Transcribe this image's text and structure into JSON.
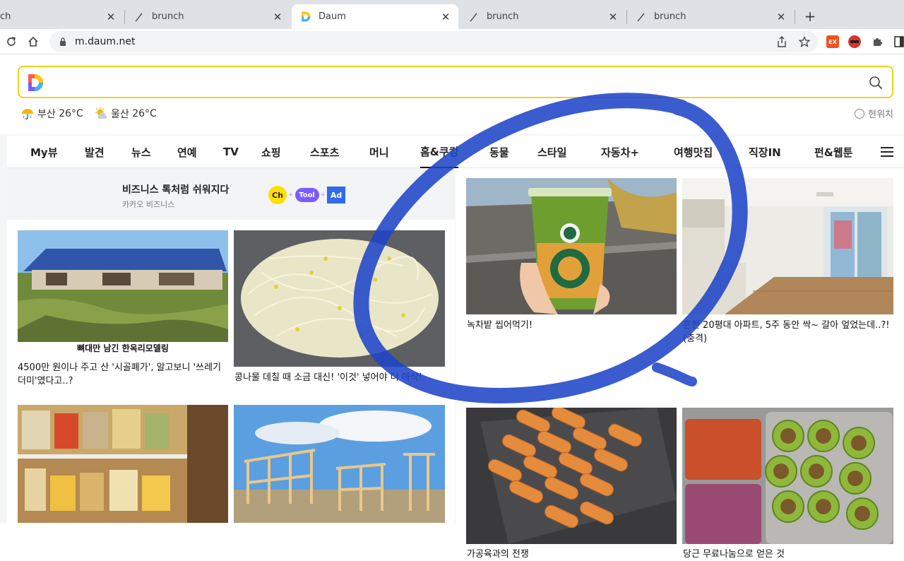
{
  "browser": {
    "tabs": [
      {
        "title": "ch",
        "icon": "page-icon",
        "active": false
      },
      {
        "title": "brunch",
        "icon": "brunch-pen-icon",
        "active": false
      },
      {
        "title": "Daum",
        "icon": "daum-logo-icon",
        "active": true
      },
      {
        "title": "brunch",
        "icon": "brunch-pen-icon",
        "active": false
      },
      {
        "title": "brunch",
        "icon": "brunch-pen-icon",
        "active": false
      }
    ],
    "new_tab": "+",
    "close_glyph": "✕",
    "url": "m.daum.net",
    "extensions": [
      {
        "label": "EX",
        "color": "#f25022"
      },
      {
        "label": "",
        "color": "#e03131"
      }
    ]
  },
  "search": {
    "placeholder": "",
    "brand_colors": [
      "#ff5a5a",
      "#ffc800",
      "#3ab4ff",
      "#7b5cff"
    ]
  },
  "weather": [
    {
      "city": "부산",
      "temp": "26°C",
      "icon": "rain-umbrella-icon"
    },
    {
      "city": "울산",
      "temp": "26°C",
      "icon": "sun-cloud-icon"
    }
  ],
  "location_label": "현위치",
  "nav": {
    "items": [
      "My뷰",
      "발견",
      "뉴스",
      "연예",
      "TV",
      "쇼핑",
      "스포츠",
      "머니",
      "홈&쿠킹",
      "동물",
      "스타일",
      "자동차+",
      "여행맛집",
      "직장IN",
      "펀&웹툰"
    ],
    "active": "홈&쿠킹"
  },
  "ad": {
    "title": "비즈니스 톡처럼 쉬워지다",
    "subtitle": "카카오 비즈니스",
    "badges": [
      "Ch",
      "Tool",
      "Ad"
    ]
  },
  "cards_left": [
    {
      "caption": "4500만 원이나 주고 산 '시골폐가', 알고보니 '쓰레기더미'였다고..?",
      "image_text": "뼈대만 남긴 한옥리모델링"
    },
    {
      "caption": "콩나물 데칠 때 소금 대신! '이것' 넣어야 더 아삭!"
    },
    {
      "caption": ""
    },
    {
      "caption": ""
    }
  ],
  "cards_right": [
    {
      "caption": "녹차밭 씹어먹기!"
    },
    {
      "caption": "흔한 20평대 아파트, 5주 동안 싹~ 갈아 엎었는데..?!(충격)"
    },
    {
      "caption": "가공육과의 전쟁"
    },
    {
      "caption": "당근 무료나눔으로 얻은 것"
    }
  ],
  "colors": {
    "search_border": "#f4d11b",
    "annotation_stroke": "#1f46c8"
  }
}
